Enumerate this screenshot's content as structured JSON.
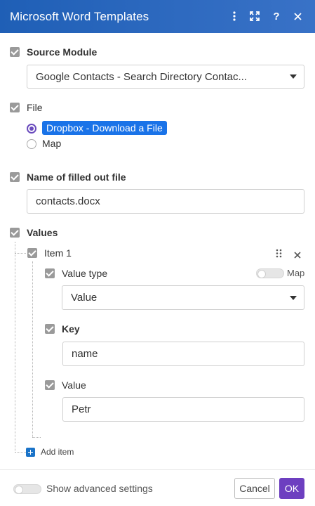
{
  "header": {
    "title": "Microsoft Word Templates",
    "icons": [
      "more-vertical-icon",
      "expand-icon",
      "help-icon",
      "close-icon"
    ]
  },
  "source_module": {
    "label": "Source Module",
    "value": "Google Contacts - Search Directory Contac..."
  },
  "file": {
    "label": "File",
    "options": [
      "Dropbox - Download a File",
      "Map"
    ],
    "selected": "Dropbox - Download a File"
  },
  "name_of_file": {
    "label": "Name of filled out file",
    "value": "contacts.docx"
  },
  "values": {
    "label": "Values",
    "item": {
      "label": "Item 1",
      "value_type": {
        "label": "Value type",
        "toggle_label": "Map",
        "value": "Value"
      },
      "key": {
        "label": "Key",
        "value": "name"
      },
      "value": {
        "label": "Value",
        "value": "Petr"
      }
    },
    "add_item_label": "Add item"
  },
  "footer": {
    "advanced_label": "Show advanced settings",
    "cancel_label": "Cancel",
    "ok_label": "OK"
  },
  "colors": {
    "header_start": "#1f5fb6",
    "header_end": "#3972c7",
    "accent_purple": "#6d3fc0",
    "selected_blue": "#1a73e8"
  }
}
